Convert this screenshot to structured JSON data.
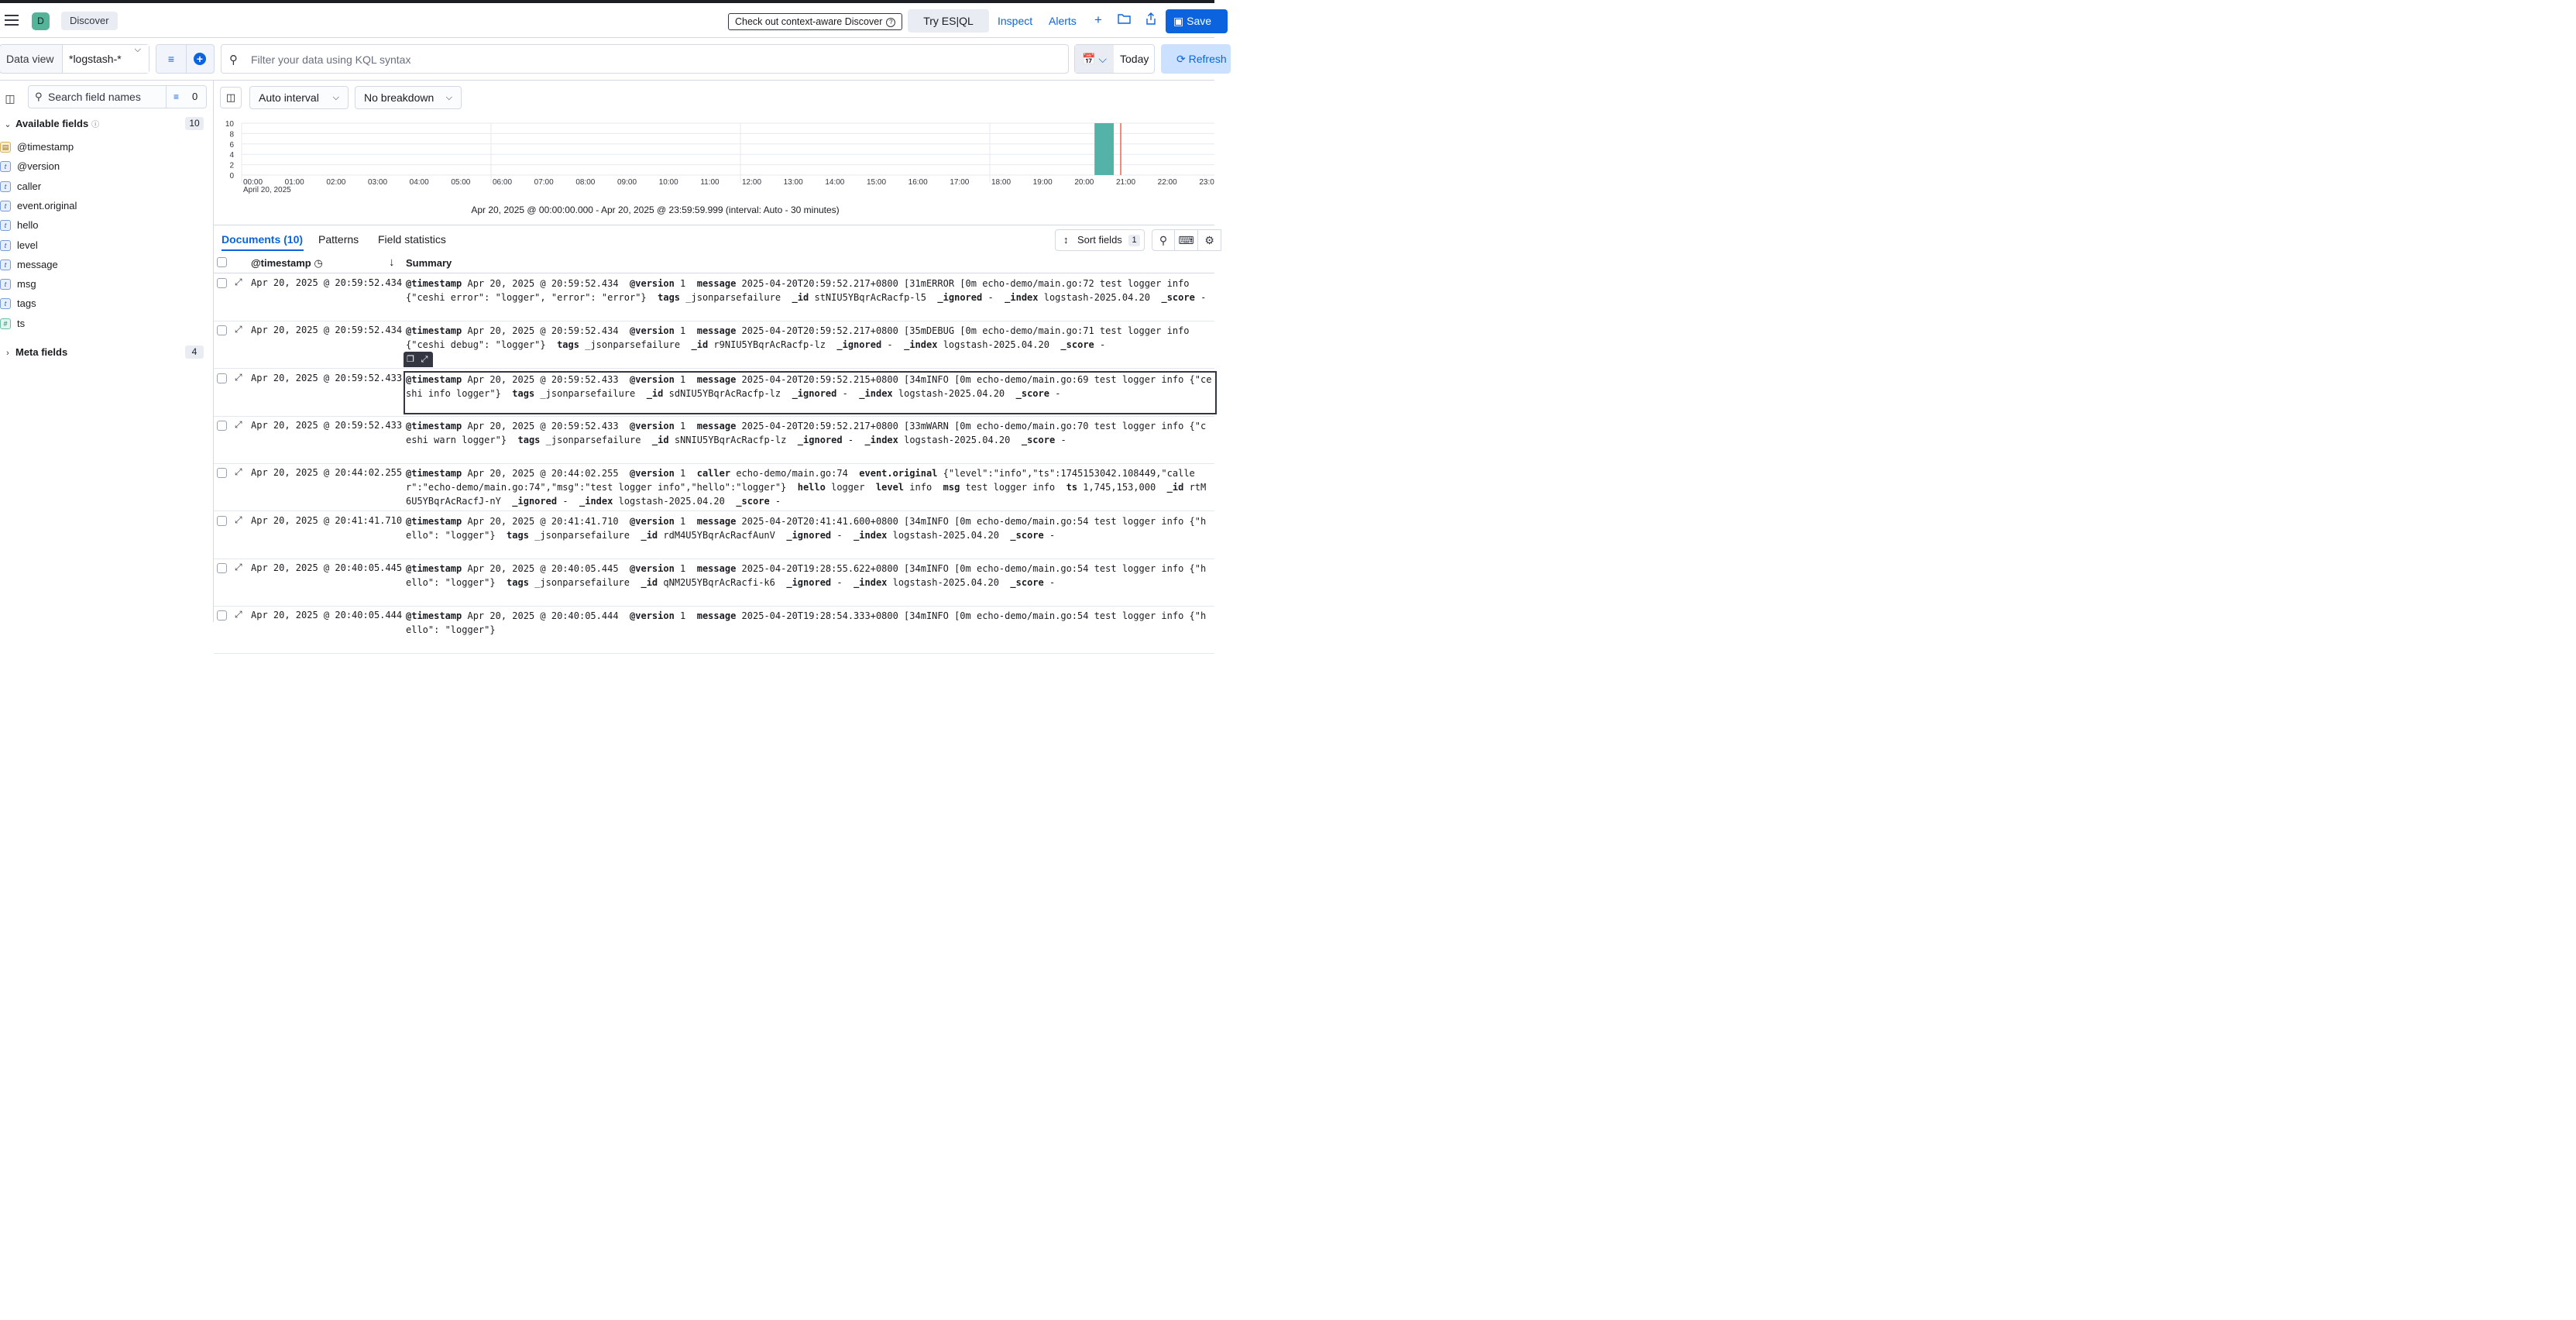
{
  "header": {
    "avatar_letter": "D",
    "breadcrumb": "Discover",
    "context_link": "Check out context-aware Discover",
    "esql_button": "Try ES|QL",
    "inspect": "Inspect",
    "alerts": "Alerts",
    "save_label": "Save"
  },
  "query": {
    "data_view_label": "Data view",
    "data_view_value": "*logstash-*",
    "kql_placeholder": "Filter your data using KQL syntax",
    "date_label": "Today",
    "refresh_label": "Refresh"
  },
  "sidebar": {
    "search_placeholder": "Search field names",
    "filter_count": "0",
    "available_label": "Available fields",
    "available_count": "10",
    "fields": [
      {
        "name": "@timestamp",
        "type": "date",
        "glyph": "▤"
      },
      {
        "name": "@version",
        "type": "string",
        "glyph": "t"
      },
      {
        "name": "caller",
        "type": "string",
        "glyph": "t"
      },
      {
        "name": "event.original",
        "type": "string",
        "glyph": "t"
      },
      {
        "name": "hello",
        "type": "string",
        "glyph": "t"
      },
      {
        "name": "level",
        "type": "string",
        "glyph": "t"
      },
      {
        "name": "message",
        "type": "string",
        "glyph": "t"
      },
      {
        "name": "msg",
        "type": "string",
        "glyph": "t"
      },
      {
        "name": "tags",
        "type": "string",
        "glyph": "t"
      },
      {
        "name": "ts",
        "type": "number",
        "glyph": "#"
      }
    ],
    "meta_label": "Meta fields",
    "meta_count": "4"
  },
  "toolbar": {
    "interval": "Auto interval",
    "breakdown": "No breakdown"
  },
  "chart_data": {
    "type": "bar",
    "y_ticks": [
      "10",
      "8",
      "6",
      "4",
      "2",
      "0"
    ],
    "ylim": [
      0,
      10
    ],
    "x_ticks": [
      "00:00",
      "01:00",
      "02:00",
      "03:00",
      "04:00",
      "05:00",
      "06:00",
      "07:00",
      "08:00",
      "09:00",
      "10:00",
      "11:00",
      "12:00",
      "13:00",
      "14:00",
      "15:00",
      "16:00",
      "17:00",
      "18:00",
      "19:00",
      "20:00",
      "21:00",
      "22:00",
      "23:00"
    ],
    "x_date_label": "April 20, 2025",
    "bars": [
      {
        "start_hour": 20.5,
        "end_hour": 21.0,
        "value": 10
      }
    ],
    "now_marker_hour": 21.15,
    "bar_color": "#54b3a9",
    "marker_color": "#e7664c",
    "grid": true
  },
  "time_range": "Apr 20, 2025 @ 00:00:00.000 - Apr 20, 2025 @ 23:59:59.999 (interval: Auto - 30 minutes)",
  "tabs": {
    "documents": "Documents (10)",
    "patterns": "Patterns",
    "field_stats": "Field statistics"
  },
  "sort": {
    "label": "Sort fields",
    "count": "1"
  },
  "grid": {
    "col_timestamp": "@timestamp",
    "col_summary": "Summary",
    "rows": [
      {
        "ts": "Apr 20, 2025 @ 20:59:52.434",
        "parts": [
          [
            "@timestamp",
            "Apr 20, 2025 @ 20:59:52.434"
          ],
          [
            "@version",
            "1"
          ],
          [
            "message",
            "2025-04-20T20:59:52.217+0800 [31mERROR [0m echo-demo/main.go:72 test logger info {\"ceshi error\": \"logger\", \"error\": \"error\"}"
          ],
          [
            "tags",
            "_jsonparsefailure"
          ],
          [
            "_id",
            "stNIU5YBqrAcRacfp-l5"
          ],
          [
            "_ignored",
            "-"
          ],
          [
            "_index",
            "logstash-2025.04.20"
          ],
          [
            "_score",
            "-"
          ]
        ]
      },
      {
        "ts": "Apr 20, 2025 @ 20:59:52.434",
        "parts": [
          [
            "@timestamp",
            "Apr 20, 2025 @ 20:59:52.434"
          ],
          [
            "@version",
            "1"
          ],
          [
            "message",
            "2025-04-20T20:59:52.217+0800 [35mDEBUG [0m echo-demo/main.go:71 test logger info {\"ceshi debug\": \"logger\"}"
          ],
          [
            "tags",
            "_jsonparsefailure"
          ],
          [
            "_id",
            "r9NIU5YBqrAcRacfp-lz"
          ],
          [
            "_ignored",
            "-"
          ],
          [
            "_index",
            "logstash-2025.04.20"
          ],
          [
            "_score",
            "-"
          ]
        ]
      },
      {
        "ts": "Apr 20, 2025 @ 20:59:52.433",
        "parts": [
          [
            "@timestamp",
            "Apr 20, 2025 @ 20:59:52.433"
          ],
          [
            "@version",
            "1"
          ],
          [
            "message",
            "2025-04-20T20:59:52.215+0800 [34mINFO [0m echo-demo/main.go:69 test logger info {\"ceshi info logger\"}"
          ],
          [
            "tags",
            "_jsonparsefailure"
          ],
          [
            "_id",
            "sdNIU5YBqrAcRacfp-lz"
          ],
          [
            "_ignored",
            "-"
          ],
          [
            "_index",
            "logstash-2025.04.20"
          ],
          [
            "_score",
            "-"
          ]
        ]
      },
      {
        "ts": "Apr 20, 2025 @ 20:59:52.433",
        "parts": [
          [
            "@timestamp",
            "Apr 20, 2025 @ 20:59:52.433"
          ],
          [
            "@version",
            "1"
          ],
          [
            "message",
            "2025-04-20T20:59:52.217+0800 [33mWARN [0m echo-demo/main.go:70 test logger info {\"ceshi warn logger\"}"
          ],
          [
            "tags",
            "_jsonparsefailure"
          ],
          [
            "_id",
            "sNNIU5YBqrAcRacfp-lz"
          ],
          [
            "_ignored",
            "-"
          ],
          [
            "_index",
            "logstash-2025.04.20"
          ],
          [
            "_score",
            "-"
          ]
        ]
      },
      {
        "ts": "Apr 20, 2025 @ 20:44:02.255",
        "parts": [
          [
            "@timestamp",
            "Apr 20, 2025 @ 20:44:02.255"
          ],
          [
            "@version",
            "1"
          ],
          [
            "caller",
            "echo-demo/main.go:74"
          ],
          [
            "event.original",
            "{\"level\":\"info\",\"ts\":1745153042.108449,\"caller\":\"echo-demo/main.go:74\",\"msg\":\"test logger info\",\"hello\":\"logger\"}"
          ],
          [
            "hello",
            "logger"
          ],
          [
            "level",
            "info"
          ],
          [
            "msg",
            "test logger info"
          ],
          [
            "ts",
            "1,745,153,000"
          ],
          [
            "_id",
            "rtM6U5YBqrAcRacfJ-nY"
          ],
          [
            "_ignored",
            "-"
          ],
          [
            "_index",
            "logstash-2025.04.20"
          ],
          [
            "_score",
            "-"
          ]
        ]
      },
      {
        "ts": "Apr 20, 2025 @ 20:41:41.710",
        "parts": [
          [
            "@timestamp",
            "Apr 20, 2025 @ 20:41:41.710"
          ],
          [
            "@version",
            "1"
          ],
          [
            "message",
            "2025-04-20T20:41:41.600+0800 [34mINFO [0m echo-demo/main.go:54 test logger info {\"hello\": \"logger\"}"
          ],
          [
            "tags",
            "_jsonparsefailure"
          ],
          [
            "_id",
            "rdM4U5YBqrAcRacfAunV"
          ],
          [
            "_ignored",
            "-"
          ],
          [
            "_index",
            "logstash-2025.04.20"
          ],
          [
            "_score",
            "-"
          ]
        ]
      },
      {
        "ts": "Apr 20, 2025 @ 20:40:05.445",
        "parts": [
          [
            "@timestamp",
            "Apr 20, 2025 @ 20:40:05.445"
          ],
          [
            "@version",
            "1"
          ],
          [
            "message",
            "2025-04-20T19:28:55.622+0800 [34mINFO [0m echo-demo/main.go:54 test logger info {\"hello\": \"logger\"}"
          ],
          [
            "tags",
            "_jsonparsefailure"
          ],
          [
            "_id",
            "qNM2U5YBqrAcRacfi-k6"
          ],
          [
            "_ignored",
            "-"
          ],
          [
            "_index",
            "logstash-2025.04.20"
          ],
          [
            "_score",
            "-"
          ]
        ]
      },
      {
        "ts": "Apr 20, 2025 @ 20:40:05.444",
        "parts": [
          [
            "@timestamp",
            "Apr 20, 2025 @ 20:40:05.444"
          ],
          [
            "@version",
            "1"
          ],
          [
            "message",
            "2025-04-20T19:28:54.333+0800 [34mINFO [0m echo-demo/main.go:54 test logger info {\"hello\": \"logger\"}"
          ]
        ]
      }
    ]
  }
}
